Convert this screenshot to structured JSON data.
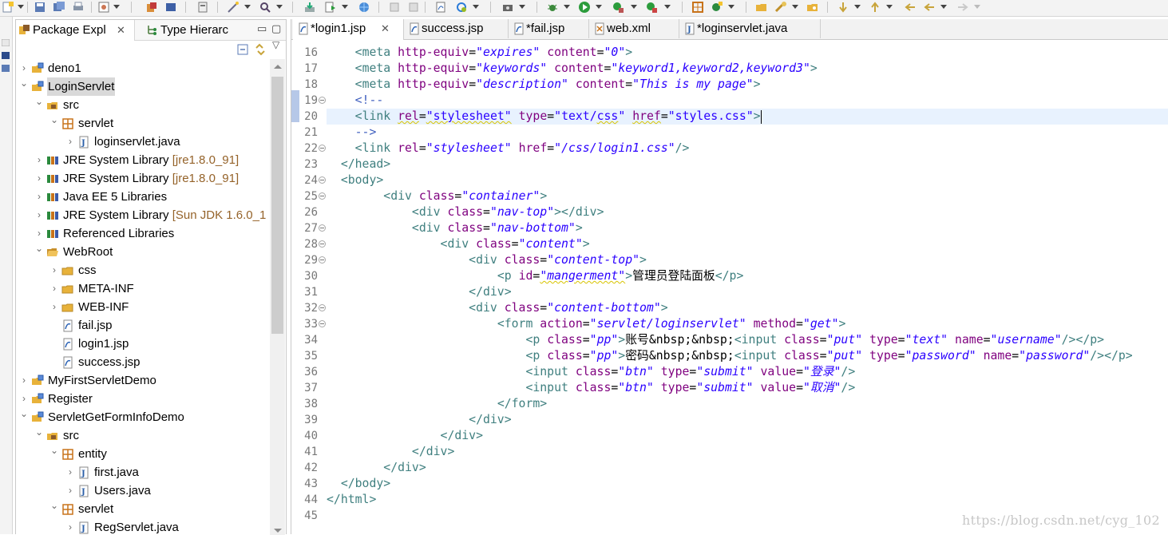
{
  "explorer": {
    "tabs": [
      {
        "label": "Package Expl",
        "icon": "package-explorer-icon",
        "active": true
      },
      {
        "label": "Type Hierarc",
        "icon": "type-hierarchy-icon",
        "active": false
      }
    ],
    "tree": [
      {
        "label": "deno1",
        "icon": "project-icon",
        "depth": 0,
        "twisty": "collapsed"
      },
      {
        "label": "LoginServlet",
        "icon": "project-icon",
        "depth": 0,
        "twisty": "expanded",
        "selected": true
      },
      {
        "label": "src",
        "icon": "source-folder-icon",
        "depth": 1,
        "twisty": "expanded"
      },
      {
        "label": "servlet",
        "icon": "package-icon",
        "depth": 2,
        "twisty": "expanded"
      },
      {
        "label": "loginservlet.java",
        "icon": "java-file-icon",
        "depth": 3,
        "twisty": "collapsed"
      },
      {
        "label": "JRE System Library",
        "decoration": "[jre1.8.0_91]",
        "icon": "library-icon",
        "depth": 1,
        "twisty": "collapsed"
      },
      {
        "label": "JRE System Library",
        "decoration": "[jre1.8.0_91]",
        "icon": "library-icon",
        "depth": 1,
        "twisty": "collapsed"
      },
      {
        "label": "Java EE 5 Libraries",
        "icon": "library-icon",
        "depth": 1,
        "twisty": "collapsed"
      },
      {
        "label": "JRE System Library",
        "decoration": "[Sun JDK 1.6.0_1",
        "icon": "library-icon",
        "depth": 1,
        "twisty": "collapsed"
      },
      {
        "label": "Referenced Libraries",
        "icon": "library-icon",
        "depth": 1,
        "twisty": "collapsed"
      },
      {
        "label": "WebRoot",
        "icon": "folder-open-icon",
        "depth": 1,
        "twisty": "expanded"
      },
      {
        "label": "css",
        "icon": "folder-icon",
        "depth": 2,
        "twisty": "collapsed"
      },
      {
        "label": "META-INF",
        "icon": "folder-icon",
        "depth": 2,
        "twisty": "collapsed"
      },
      {
        "label": "WEB-INF",
        "icon": "folder-icon",
        "depth": 2,
        "twisty": "collapsed"
      },
      {
        "label": "fail.jsp",
        "icon": "jsp-file-icon",
        "depth": 2,
        "twisty": "none"
      },
      {
        "label": "login1.jsp",
        "icon": "jsp-file-icon",
        "depth": 2,
        "twisty": "none"
      },
      {
        "label": "success.jsp",
        "icon": "jsp-file-icon",
        "depth": 2,
        "twisty": "none"
      },
      {
        "label": "MyFirstServletDemo",
        "icon": "project-icon",
        "depth": 0,
        "twisty": "collapsed"
      },
      {
        "label": "Register",
        "icon": "project-icon",
        "depth": 0,
        "twisty": "collapsed"
      },
      {
        "label": "ServletGetFormInfoDemo",
        "icon": "project-icon",
        "depth": 0,
        "twisty": "expanded"
      },
      {
        "label": "src",
        "icon": "source-folder-icon",
        "depth": 1,
        "twisty": "expanded"
      },
      {
        "label": "entity",
        "icon": "package-icon",
        "depth": 2,
        "twisty": "expanded"
      },
      {
        "label": "first.java",
        "icon": "java-file-icon",
        "depth": 3,
        "twisty": "collapsed"
      },
      {
        "label": "Users.java",
        "icon": "java-file-icon",
        "depth": 3,
        "twisty": "collapsed"
      },
      {
        "label": "servlet",
        "icon": "package-icon",
        "depth": 2,
        "twisty": "expanded"
      },
      {
        "label": "RegServlet.java",
        "icon": "java-file-icon",
        "depth": 3,
        "twisty": "collapsed"
      }
    ]
  },
  "editor": {
    "tabs": [
      {
        "label": "*login1.jsp",
        "icon": "jsp-file-icon",
        "active": true,
        "closable": true
      },
      {
        "label": "success.jsp",
        "icon": "jsp-file-icon",
        "active": false
      },
      {
        "label": "*fail.jsp",
        "icon": "jsp-file-icon",
        "active": false
      },
      {
        "label": "web.xml",
        "icon": "xml-file-icon",
        "active": false
      },
      {
        "label": "*loginservlet.java",
        "icon": "java-file-icon",
        "active": false
      }
    ],
    "lines": [
      {
        "n": "16",
        "indent": 4,
        "tokens": [
          [
            "t",
            "<"
          ],
          [
            "t",
            "meta "
          ],
          [
            "a",
            "http-equiv"
          ],
          [
            "p",
            "="
          ],
          [
            "v",
            "\"expires\""
          ],
          [
            "p",
            " "
          ],
          [
            "a",
            "content"
          ],
          [
            "p",
            "="
          ],
          [
            "v",
            "\"0\""
          ],
          [
            "t",
            ">"
          ]
        ]
      },
      {
        "n": "17",
        "indent": 4,
        "tokens": [
          [
            "t",
            "<"
          ],
          [
            "t",
            "meta "
          ],
          [
            "a",
            "http-equiv"
          ],
          [
            "p",
            "="
          ],
          [
            "v",
            "\"keywords\""
          ],
          [
            "p",
            " "
          ],
          [
            "a",
            "content"
          ],
          [
            "p",
            "="
          ],
          [
            "v",
            "\"keyword1,keyword2,keyword3\""
          ],
          [
            "t",
            ">"
          ]
        ]
      },
      {
        "n": "18",
        "indent": 4,
        "tokens": [
          [
            "t",
            "<"
          ],
          [
            "t",
            "meta "
          ],
          [
            "a",
            "http-equiv"
          ],
          [
            "p",
            "="
          ],
          [
            "v",
            "\"description\""
          ],
          [
            "p",
            " "
          ],
          [
            "a",
            "content"
          ],
          [
            "p",
            "="
          ],
          [
            "v",
            "\"This is my page\""
          ],
          [
            "t",
            ">"
          ]
        ]
      },
      {
        "n": "19",
        "indent": 4,
        "fold": true,
        "tokens": [
          [
            "c",
            "<!--"
          ]
        ]
      },
      {
        "n": "20",
        "indent": 4,
        "current": true,
        "tokens": [
          [
            "t",
            "<"
          ],
          [
            "t",
            "link "
          ],
          [
            "aw",
            "rel"
          ],
          [
            "p",
            "="
          ],
          [
            "vnw",
            "\"stylesheet\""
          ],
          [
            "p",
            " "
          ],
          [
            "a",
            "type"
          ],
          [
            "p",
            "="
          ],
          [
            "vn",
            "\"text/"
          ],
          [
            "vnw",
            "css"
          ],
          [
            "vn",
            "\""
          ],
          [
            "p",
            " "
          ],
          [
            "aw",
            "href"
          ],
          [
            "p",
            "="
          ],
          [
            "vn",
            "\"styles.css\""
          ],
          [
            "t",
            ">"
          ],
          [
            "caret",
            ""
          ]
        ]
      },
      {
        "n": "21",
        "indent": 4,
        "tokens": [
          [
            "c",
            "-->"
          ]
        ]
      },
      {
        "n": "22",
        "indent": 4,
        "fold": true,
        "tokens": [
          [
            "t",
            "<"
          ],
          [
            "t",
            "link "
          ],
          [
            "a",
            "rel"
          ],
          [
            "p",
            "="
          ],
          [
            "v",
            "\"stylesheet\""
          ],
          [
            "p",
            " "
          ],
          [
            "a",
            "href"
          ],
          [
            "p",
            "="
          ],
          [
            "v",
            "\"/css/login1.css\""
          ],
          [
            "t",
            "/>"
          ]
        ]
      },
      {
        "n": "23",
        "indent": 2,
        "tokens": [
          [
            "t",
            "</head>"
          ]
        ]
      },
      {
        "n": "24",
        "indent": 2,
        "fold": true,
        "tokens": [
          [
            "t",
            "<body>"
          ]
        ]
      },
      {
        "n": "25",
        "indent": 8,
        "fold": true,
        "tokens": [
          [
            "t",
            "<"
          ],
          [
            "t",
            "div "
          ],
          [
            "a",
            "class"
          ],
          [
            "p",
            "="
          ],
          [
            "v",
            "\"container\""
          ],
          [
            "t",
            ">"
          ]
        ]
      },
      {
        "n": "26",
        "indent": 12,
        "tokens": [
          [
            "t",
            "<"
          ],
          [
            "t",
            "div "
          ],
          [
            "a",
            "class"
          ],
          [
            "p",
            "="
          ],
          [
            "v",
            "\"nav-top\""
          ],
          [
            "t",
            "></div>"
          ]
        ]
      },
      {
        "n": "27",
        "indent": 12,
        "fold": true,
        "tokens": [
          [
            "t",
            "<"
          ],
          [
            "t",
            "div "
          ],
          [
            "a",
            "class"
          ],
          [
            "p",
            "="
          ],
          [
            "v",
            "\"nav-bottom\""
          ],
          [
            "t",
            ">"
          ]
        ]
      },
      {
        "n": "28",
        "indent": 16,
        "fold": true,
        "tokens": [
          [
            "t",
            "<"
          ],
          [
            "t",
            "div "
          ],
          [
            "a",
            "class"
          ],
          [
            "p",
            "="
          ],
          [
            "v",
            "\"content\""
          ],
          [
            "t",
            ">"
          ]
        ]
      },
      {
        "n": "29",
        "indent": 20,
        "fold": true,
        "tokens": [
          [
            "t",
            "<"
          ],
          [
            "t",
            "div "
          ],
          [
            "a",
            "class"
          ],
          [
            "p",
            "="
          ],
          [
            "v",
            "\"content-top\""
          ],
          [
            "t",
            ">"
          ]
        ]
      },
      {
        "n": "30",
        "indent": 24,
        "tokens": [
          [
            "t",
            "<"
          ],
          [
            "t",
            "p "
          ],
          [
            "a",
            "id"
          ],
          [
            "p",
            "="
          ],
          [
            "vw",
            "\"mangerment\""
          ],
          [
            "t",
            ">"
          ],
          [
            "e",
            "管理员登陆面板"
          ],
          [
            "t",
            "</p>"
          ]
        ]
      },
      {
        "n": "31",
        "indent": 20,
        "tokens": [
          [
            "t",
            "</div>"
          ]
        ]
      },
      {
        "n": "32",
        "indent": 20,
        "fold": true,
        "tokens": [
          [
            "t",
            "<"
          ],
          [
            "t",
            "div "
          ],
          [
            "a",
            "class"
          ],
          [
            "p",
            "="
          ],
          [
            "v",
            "\"content-bottom\""
          ],
          [
            "t",
            ">"
          ]
        ]
      },
      {
        "n": "33",
        "indent": 24,
        "fold": true,
        "tokens": [
          [
            "t",
            "<"
          ],
          [
            "t",
            "form "
          ],
          [
            "a",
            "action"
          ],
          [
            "p",
            "="
          ],
          [
            "v",
            "\"servlet/loginservlet\""
          ],
          [
            "p",
            " "
          ],
          [
            "a",
            "method"
          ],
          [
            "p",
            "="
          ],
          [
            "v",
            "\"get\""
          ],
          [
            "t",
            ">"
          ]
        ]
      },
      {
        "n": "34",
        "indent": 28,
        "tokens": [
          [
            "t",
            "<"
          ],
          [
            "t",
            "p "
          ],
          [
            "a",
            "class"
          ],
          [
            "p",
            "="
          ],
          [
            "v",
            "\"pp\""
          ],
          [
            "t",
            ">"
          ],
          [
            "e",
            "账号&nbsp;&nbsp;"
          ],
          [
            "t",
            "<"
          ],
          [
            "t",
            "input "
          ],
          [
            "a",
            "class"
          ],
          [
            "p",
            "="
          ],
          [
            "v",
            "\"put\""
          ],
          [
            "p",
            " "
          ],
          [
            "a",
            "type"
          ],
          [
            "p",
            "="
          ],
          [
            "v",
            "\"text\""
          ],
          [
            "p",
            " "
          ],
          [
            "a",
            "name"
          ],
          [
            "p",
            "="
          ],
          [
            "v",
            "\"username\""
          ],
          [
            "t",
            "/></p>"
          ]
        ]
      },
      {
        "n": "35",
        "indent": 28,
        "tokens": [
          [
            "t",
            "<"
          ],
          [
            "t",
            "p "
          ],
          [
            "a",
            "class"
          ],
          [
            "p",
            "="
          ],
          [
            "v",
            "\"pp\""
          ],
          [
            "t",
            ">"
          ],
          [
            "e",
            "密码&nbsp;&nbsp;"
          ],
          [
            "t",
            "<"
          ],
          [
            "t",
            "input "
          ],
          [
            "a",
            "class"
          ],
          [
            "p",
            "="
          ],
          [
            "v",
            "\"put\""
          ],
          [
            "p",
            " "
          ],
          [
            "a",
            "type"
          ],
          [
            "p",
            "="
          ],
          [
            "v",
            "\"password\""
          ],
          [
            "p",
            " "
          ],
          [
            "a",
            "name"
          ],
          [
            "p",
            "="
          ],
          [
            "v",
            "\"password\""
          ],
          [
            "t",
            "/></p>"
          ]
        ]
      },
      {
        "n": "36",
        "indent": 28,
        "tokens": [
          [
            "t",
            "<"
          ],
          [
            "t",
            "input "
          ],
          [
            "a",
            "class"
          ],
          [
            "p",
            "="
          ],
          [
            "v",
            "\"btn\""
          ],
          [
            "p",
            " "
          ],
          [
            "a",
            "type"
          ],
          [
            "p",
            "="
          ],
          [
            "v",
            "\"submit\""
          ],
          [
            "p",
            " "
          ],
          [
            "a",
            "value"
          ],
          [
            "p",
            "="
          ],
          [
            "v",
            "\"登录\""
          ],
          [
            "t",
            "/>"
          ]
        ]
      },
      {
        "n": "37",
        "indent": 28,
        "tokens": [
          [
            "t",
            "<"
          ],
          [
            "t",
            "input "
          ],
          [
            "a",
            "class"
          ],
          [
            "p",
            "="
          ],
          [
            "v",
            "\"btn\""
          ],
          [
            "p",
            " "
          ],
          [
            "a",
            "type"
          ],
          [
            "p",
            "="
          ],
          [
            "v",
            "\"submit\""
          ],
          [
            "p",
            " "
          ],
          [
            "a",
            "value"
          ],
          [
            "p",
            "="
          ],
          [
            "v",
            "\"取消\""
          ],
          [
            "t",
            "/>"
          ]
        ]
      },
      {
        "n": "38",
        "indent": 24,
        "tokens": [
          [
            "t",
            "</form>"
          ]
        ]
      },
      {
        "n": "39",
        "indent": 20,
        "tokens": [
          [
            "t",
            "</div>"
          ]
        ]
      },
      {
        "n": "40",
        "indent": 16,
        "tokens": [
          [
            "t",
            "</div>"
          ]
        ]
      },
      {
        "n": "41",
        "indent": 12,
        "tokens": [
          [
            "t",
            "</div>"
          ]
        ]
      },
      {
        "n": "42",
        "indent": 8,
        "tokens": [
          [
            "t",
            "</div>"
          ]
        ]
      },
      {
        "n": "43",
        "indent": 2,
        "tokens": [
          [
            "t",
            "</body>"
          ]
        ]
      },
      {
        "n": "44",
        "indent": 0,
        "tokens": [
          [
            "t",
            "</html>"
          ]
        ]
      },
      {
        "n": "45",
        "indent": 0,
        "tokens": []
      }
    ]
  },
  "watermark": "https://blog.csdn.net/cyg_102",
  "colors": {
    "tag": "#3f7f7f",
    "attribute": "#7f007f",
    "value": "#2a00ff",
    "comment": "#3f5fbf",
    "current_line": "#e8f2fe",
    "selection": "#d9d9d9"
  }
}
